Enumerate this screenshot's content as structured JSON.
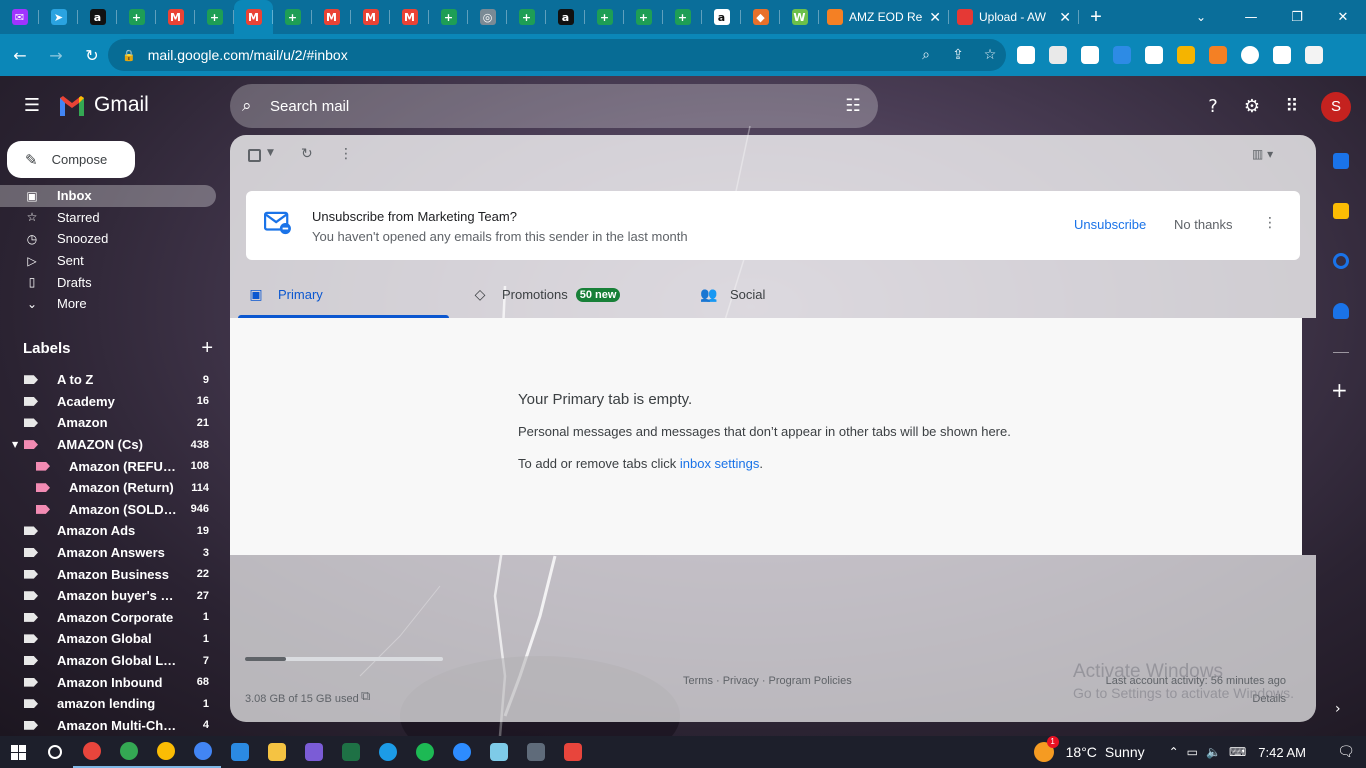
{
  "browser": {
    "pinned_tab_icons": [
      {
        "name": "messenger-icon",
        "color": "#a033ff",
        "glyph": "✉"
      },
      {
        "name": "telegram-icon",
        "color": "#2aa3e0",
        "glyph": "➤"
      },
      {
        "name": "amazon-icon",
        "color": "#111111",
        "glyph": "a"
      },
      {
        "name": "sheets-icon",
        "color": "#1e9e55",
        "glyph": "+"
      },
      {
        "name": "gmail-icon",
        "color": "#ea4335",
        "glyph": "M"
      },
      {
        "name": "sheets-icon",
        "color": "#1e9e55",
        "glyph": "+"
      },
      {
        "name": "gmail-icon",
        "color": "#ea4335",
        "glyph": "M"
      },
      {
        "name": "sheets-icon",
        "color": "#1e9e55",
        "glyph": "+"
      },
      {
        "name": "gmail-icon",
        "color": "#ea4335",
        "glyph": "M"
      },
      {
        "name": "gmail-icon",
        "color": "#ea4335",
        "glyph": "M"
      },
      {
        "name": "gmail-icon",
        "color": "#ea4335",
        "glyph": "M"
      },
      {
        "name": "sheets-icon",
        "color": "#1e9e55",
        "glyph": "+"
      },
      {
        "name": "globe-icon",
        "color": "#7a8a95",
        "glyph": "◎"
      },
      {
        "name": "sheets-icon",
        "color": "#1e9e55",
        "glyph": "+"
      },
      {
        "name": "amazon-icon",
        "color": "#111111",
        "glyph": "a"
      },
      {
        "name": "sheets-icon",
        "color": "#1e9e55",
        "glyph": "+"
      },
      {
        "name": "sheets-icon",
        "color": "#1e9e55",
        "glyph": "+"
      },
      {
        "name": "sheets-icon",
        "color": "#1e9e55",
        "glyph": "+"
      },
      {
        "name": "amazon-icon",
        "color": "#ffffff",
        "glyph": "a"
      },
      {
        "name": "aws-icon",
        "color": "#e8702a",
        "glyph": "◆"
      },
      {
        "name": "w-app-icon",
        "color": "#6cc04a",
        "glyph": "W"
      }
    ],
    "active_tab_index": 6,
    "tabs": [
      {
        "title": "AMZ EOD Re",
        "color": "#f48024"
      },
      {
        "title": "Upload - AW",
        "color": "#e53935"
      }
    ],
    "url": "mail.google.com/mail/u/2/#inbox",
    "extension_colors": [
      "#ffffff",
      "#e9e9e9",
      "#ffffff",
      "#2d8be5",
      "#ffffff",
      "#f5b400",
      "#f48024",
      "#ffffff",
      "#ffffff",
      "#f3f3f3"
    ]
  },
  "gmail": {
    "brand": "Gmail",
    "search_placeholder": "Search mail",
    "avatar_letter": "S",
    "compose_label": "Compose",
    "nav": [
      {
        "label": "Inbox",
        "icon": "inbox-icon",
        "glyph": "▣",
        "selected": true
      },
      {
        "label": "Starred",
        "icon": "star-icon",
        "glyph": "☆",
        "selected": false
      },
      {
        "label": "Snoozed",
        "icon": "clock-icon",
        "glyph": "◷",
        "selected": false
      },
      {
        "label": "Sent",
        "icon": "send-icon",
        "glyph": "▷",
        "selected": false
      },
      {
        "label": "Drafts",
        "icon": "draft-icon",
        "glyph": "▯",
        "selected": false
      },
      {
        "label": "More",
        "icon": "chevron-down-icon",
        "glyph": "⌄",
        "selected": false
      }
    ],
    "labels_title": "Labels",
    "labels": [
      {
        "name": "A to Z",
        "count": "9",
        "sub": false,
        "pink": false,
        "caret": false
      },
      {
        "name": "Academy",
        "count": "16",
        "sub": false,
        "pink": false,
        "caret": false
      },
      {
        "name": "Amazon",
        "count": "21",
        "sub": false,
        "pink": false,
        "caret": false
      },
      {
        "name": "AMAZON (Cs)",
        "count": "438",
        "sub": false,
        "pink": true,
        "caret": true
      },
      {
        "name": "Amazon (REFU…",
        "count": "108",
        "sub": true,
        "pink": true,
        "caret": false
      },
      {
        "name": "Amazon (Return)",
        "count": "114",
        "sub": true,
        "pink": true,
        "caret": false
      },
      {
        "name": "Amazon (SOLD …",
        "count": "946",
        "sub": true,
        "pink": true,
        "caret": false
      },
      {
        "name": "Amazon Ads",
        "count": "19",
        "sub": false,
        "pink": false,
        "caret": false
      },
      {
        "name": "Amazon Answers",
        "count": "3",
        "sub": false,
        "pink": false,
        "caret": false
      },
      {
        "name": "Amazon Business",
        "count": "22",
        "sub": false,
        "pink": false,
        "caret": false
      },
      {
        "name": "Amazon buyer's m…",
        "count": "27",
        "sub": false,
        "pink": false,
        "caret": false
      },
      {
        "name": "Amazon Corporate",
        "count": "1",
        "sub": false,
        "pink": false,
        "caret": false
      },
      {
        "name": "Amazon Global",
        "count": "1",
        "sub": false,
        "pink": false,
        "caret": false
      },
      {
        "name": "Amazon Global Logi…",
        "count": "7",
        "sub": false,
        "pink": false,
        "caret": false
      },
      {
        "name": "Amazon Inbound",
        "count": "68",
        "sub": false,
        "pink": false,
        "caret": false
      },
      {
        "name": "amazon lending",
        "count": "1",
        "sub": false,
        "pink": false,
        "caret": false
      },
      {
        "name": "Amazon Multi-Cha…",
        "count": "4",
        "sub": false,
        "pink": false,
        "caret": false
      }
    ],
    "promo": {
      "title": "Unsubscribe from Marketing Team?",
      "subtitle": "You haven't opened any emails from this sender in the last month",
      "unsubscribe": "Unsubscribe",
      "no_thanks": "No thanks"
    },
    "tabs": {
      "primary": "Primary",
      "promotions": "Promotions",
      "promotions_badge": "50 new",
      "social": "Social"
    },
    "empty": {
      "title": "Your Primary tab is empty.",
      "line1": "Personal messages and messages that don’t appear in other tabs will be shown here.",
      "line2_prefix": "To add or remove tabs click ",
      "line2_link": "inbox settings",
      "line2_suffix": "."
    },
    "footer": {
      "storage": "3.08 GB of 15 GB used",
      "storage_fraction": 0.205,
      "links": "Terms · Privacy · Program Policies",
      "last_activity": "Last account activity: 56 minutes ago",
      "details": "Details"
    },
    "side_panel_colors": [
      "#1a73e8",
      "#fbbc04",
      "#1a73e8",
      "#1a73e8"
    ],
    "watermark": {
      "line1": "Activate Windows",
      "line2": "Go to Settings to activate Windows."
    }
  },
  "taskbar": {
    "apps": [
      {
        "name": "search-icon",
        "color": "#1d1f2b",
        "running": false
      },
      {
        "name": "chrome-icon",
        "color": "#e8453c",
        "running": true
      },
      {
        "name": "chrome-icon",
        "color": "#34a853",
        "running": true
      },
      {
        "name": "chrome-icon",
        "color": "#fbbc04",
        "running": true
      },
      {
        "name": "chrome-icon",
        "color": "#4285f4",
        "running": true
      },
      {
        "name": "paint-icon",
        "color": "#2b8ae2",
        "running": false
      },
      {
        "name": "folder-icon",
        "color": "#f5c342",
        "running": false
      },
      {
        "name": "media-icon",
        "color": "#7b5cd6",
        "running": false
      },
      {
        "name": "excel-icon",
        "color": "#1e7145",
        "running": false
      },
      {
        "name": "edge-icon",
        "color": "#1c9be6",
        "running": false
      },
      {
        "name": "spotify-icon",
        "color": "#1db954",
        "running": false
      },
      {
        "name": "zoom-icon",
        "color": "#2d8cff",
        "running": false
      },
      {
        "name": "notepad-icon",
        "color": "#7ecbe8",
        "running": false
      },
      {
        "name": "calculator-icon",
        "color": "#5f6b7a",
        "running": false
      },
      {
        "name": "snip-icon",
        "color": "#e8453c",
        "running": false
      }
    ],
    "weather_badge": "1",
    "temp": "18°C",
    "condition": "Sunny",
    "time": "7:42 AM"
  }
}
